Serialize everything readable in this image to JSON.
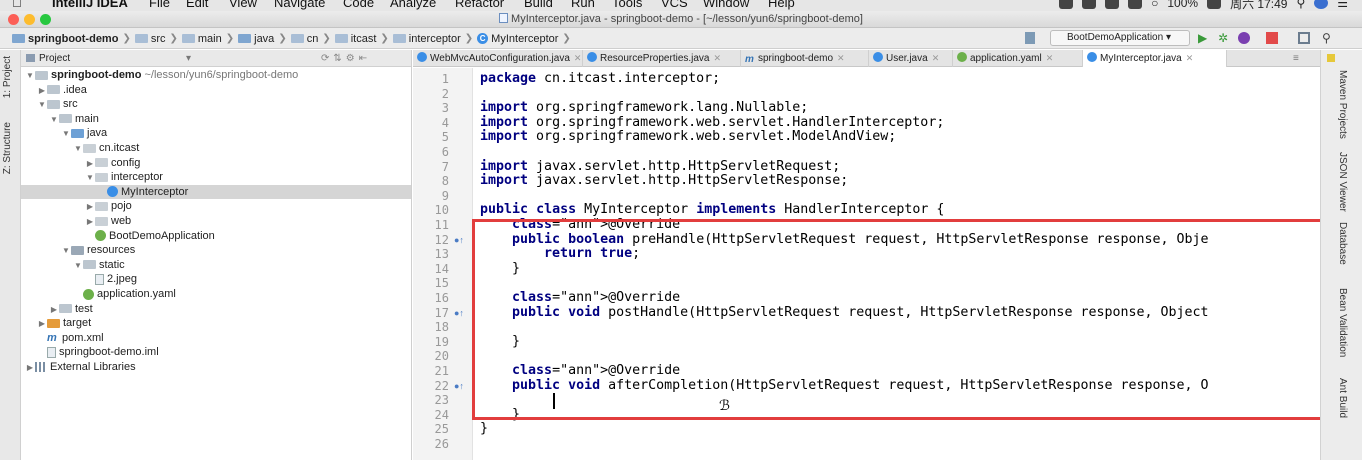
{
  "menubar": {
    "app_name": "IntelliJ IDEA",
    "items": [
      "File",
      "Edit",
      "View",
      "Navigate",
      "Code",
      "Analyze",
      "Refactor",
      "Build",
      "Run",
      "Tools",
      "VCS",
      "Window",
      "Help"
    ],
    "battery": "100%",
    "clock": "周六 17:49"
  },
  "window": {
    "title": "MyInterceptor.java - springboot-demo - [~/lesson/yun6/springboot-demo]"
  },
  "breadcrumb": [
    "springboot-demo",
    "src",
    "main",
    "java",
    "cn",
    "itcast",
    "interceptor",
    "MyInterceptor"
  ],
  "run_config": "BootDemoApplication",
  "left_tabs": [
    "1: Project",
    "Z: Structure"
  ],
  "project_panel": {
    "title": "Project",
    "tree": [
      {
        "label": "springboot-demo",
        "suffix": "~/lesson/yun6/springboot-demo",
        "depth": 0,
        "expanded": true,
        "icon": "folder-icon"
      },
      {
        "label": ".idea",
        "depth": 1,
        "expanded": false,
        "icon": "folder-icon"
      },
      {
        "label": "src",
        "depth": 1,
        "expanded": true,
        "icon": "folder-icon"
      },
      {
        "label": "main",
        "depth": 2,
        "expanded": true,
        "icon": "folder-icon"
      },
      {
        "label": "java",
        "depth": 3,
        "expanded": true,
        "icon": "source-folder-icon"
      },
      {
        "label": "cn.itcast",
        "depth": 4,
        "expanded": true,
        "icon": "package-icon"
      },
      {
        "label": "config",
        "depth": 5,
        "expanded": false,
        "icon": "package-icon"
      },
      {
        "label": "interceptor",
        "depth": 5,
        "expanded": true,
        "icon": "package-icon"
      },
      {
        "label": "MyInterceptor",
        "depth": 6,
        "icon": "class-icon",
        "selected": true
      },
      {
        "label": "pojo",
        "depth": 5,
        "expanded": false,
        "icon": "package-icon"
      },
      {
        "label": "web",
        "depth": 5,
        "expanded": false,
        "icon": "package-icon"
      },
      {
        "label": "BootDemoApplication",
        "depth": 5,
        "icon": "spring-boot-icon"
      },
      {
        "label": "resources",
        "depth": 3,
        "expanded": true,
        "icon": "resources-folder-icon"
      },
      {
        "label": "static",
        "depth": 4,
        "expanded": true,
        "icon": "folder-icon"
      },
      {
        "label": "2.jpeg",
        "depth": 5,
        "icon": "image-file-icon"
      },
      {
        "label": "application.yaml",
        "depth": 4,
        "icon": "yaml-icon"
      },
      {
        "label": "test",
        "depth": 2,
        "expanded": false,
        "icon": "folder-icon"
      },
      {
        "label": "target",
        "depth": 1,
        "expanded": false,
        "icon": "target-folder-icon"
      },
      {
        "label": "pom.xml",
        "depth": 1,
        "icon": "maven-icon"
      },
      {
        "label": "springboot-demo.iml",
        "depth": 1,
        "icon": "iml-file-icon"
      },
      {
        "label": "External Libraries",
        "depth": 0,
        "expanded": false,
        "icon": "libraries-icon"
      }
    ]
  },
  "editor_tabs": [
    {
      "label": "WebMvcAutoConfiguration.java",
      "icon": "class-icon",
      "active": false
    },
    {
      "label": "ResourceProperties.java",
      "icon": "class-icon",
      "active": false
    },
    {
      "label": "springboot-demo",
      "icon": "maven-icon",
      "active": false
    },
    {
      "label": "User.java",
      "icon": "class-icon",
      "active": false
    },
    {
      "label": "application.yaml",
      "icon": "yaml-icon",
      "active": false
    },
    {
      "label": "MyInterceptor.java",
      "icon": "class-icon",
      "active": true
    }
  ],
  "code_lines": [
    "package cn.itcast.interceptor;",
    "",
    "import org.springframework.lang.Nullable;",
    "import org.springframework.web.servlet.HandlerInterceptor;",
    "import org.springframework.web.servlet.ModelAndView;",
    "",
    "import javax.servlet.http.HttpServletRequest;",
    "import javax.servlet.http.HttpServletResponse;",
    "",
    "public class MyInterceptor implements HandlerInterceptor {",
    "    @Override",
    "    public boolean preHandle(HttpServletRequest request, HttpServletResponse response, Obje",
    "        return true;",
    "    }",
    "",
    "    @Override",
    "    public void postHandle(HttpServletRequest request, HttpServletResponse response, Object",
    "",
    "    }",
    "",
    "    @Override",
    "    public void afterCompletion(HttpServletRequest request, HttpServletResponse response, O",
    "",
    "    }",
    "}",
    ""
  ],
  "right_tabs": [
    "Maven Projects",
    "JSON Viewer",
    "Database",
    "Bean Validation",
    "Ant Build"
  ]
}
